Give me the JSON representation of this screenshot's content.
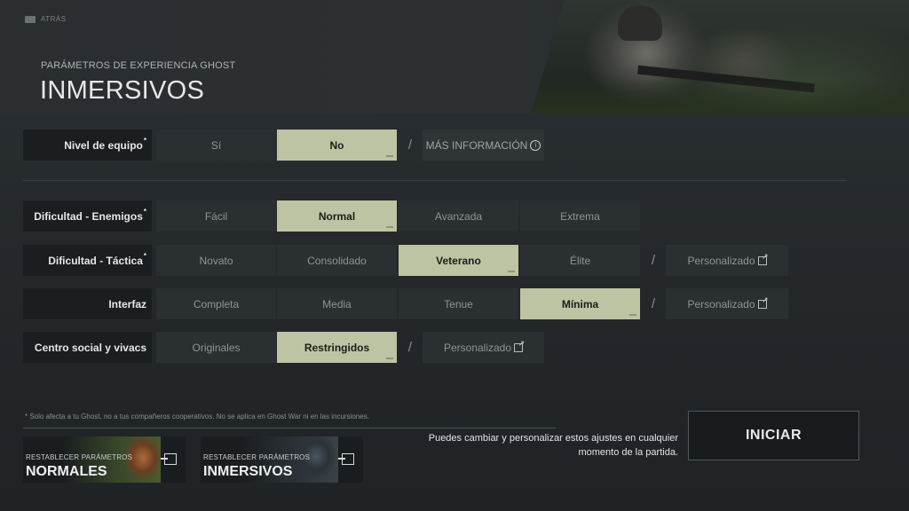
{
  "nav": {
    "back_label": "ATRÁS"
  },
  "header": {
    "subtitle": "PARÁMETROS DE EXPERIENCIA GHOST",
    "title": "INMERSIVOS"
  },
  "settings": [
    {
      "label": "Nivel de equipo",
      "options": [
        "Sí",
        "No"
      ],
      "selected": "No",
      "extra": "MÁS INFORMACIÓN"
    },
    {
      "label": "Dificultad - Enemigos",
      "options": [
        "Fácil",
        "Normal",
        "Avanzada",
        "Extrema"
      ],
      "selected": "Normal"
    },
    {
      "label": "Dificultad - Táctica",
      "options": [
        "Novato",
        "Consolidado",
        "Veterano",
        "Élite"
      ],
      "selected": "Veterano",
      "extra": "Personalizado"
    },
    {
      "label": "Interfaz",
      "options": [
        "Completa",
        "Media",
        "Tenue",
        "Mínima"
      ],
      "selected": "Mínima",
      "extra": "Personalizado"
    },
    {
      "label": "Centro social y vivacs",
      "options": [
        "Originales",
        "Restringidos"
      ],
      "selected": "Restringidos",
      "extra": "Personalizado"
    }
  ],
  "footnote": "Solo afecta a tu Ghost, no a tus compañeros cooperativos. No se aplica en Ghost War ni en las incursiones.",
  "presets": [
    {
      "line1": "RESTABLECER PARÁMETROS",
      "line2": "NORMALES"
    },
    {
      "line1": "RESTABLECER PARÁMETROS",
      "line2": "INMERSIVOS"
    }
  ],
  "hint": "Puedes cambiar y personalizar estos ajustes en cualquier momento de la partida.",
  "start_label": "INICIAR",
  "colors": {
    "selected": "#bdc4a3",
    "label_bg": "#1b1e20",
    "option_bg": "#2a2f32"
  }
}
